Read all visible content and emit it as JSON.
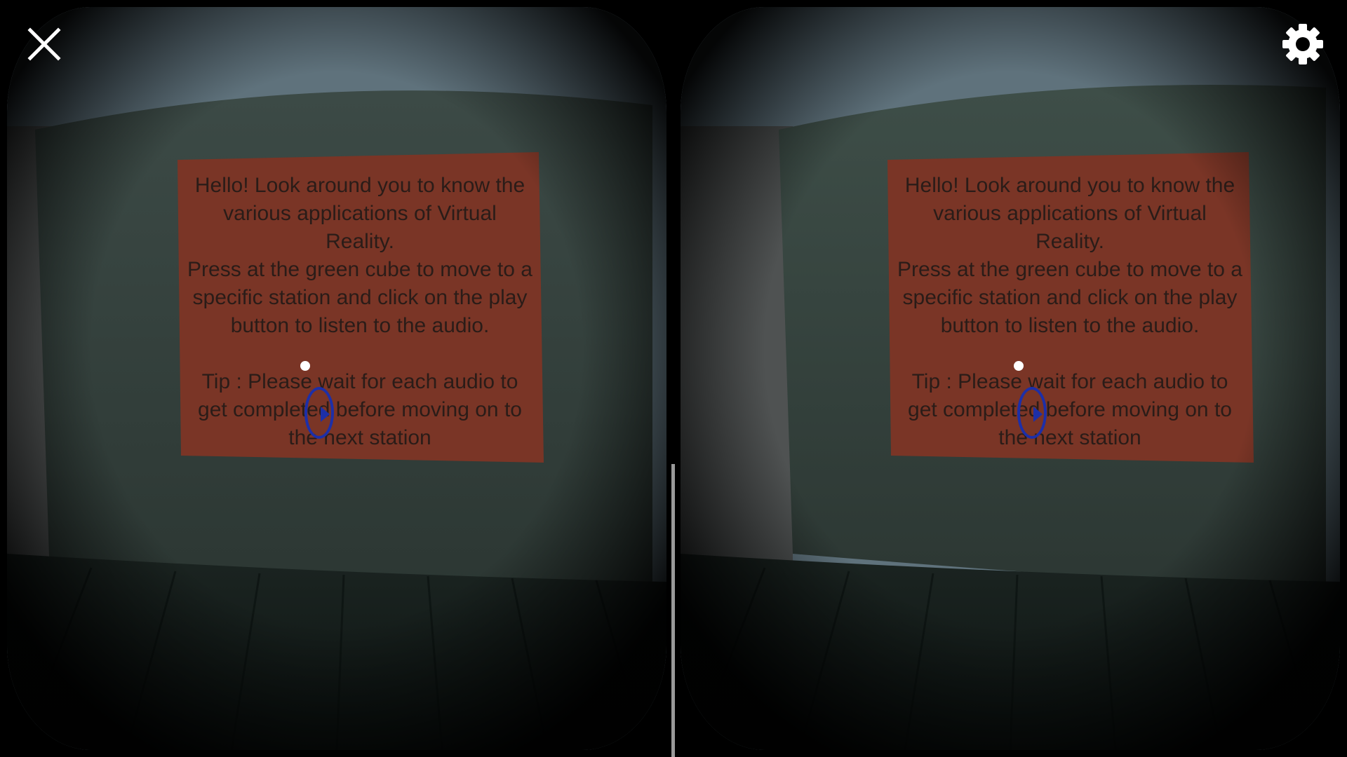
{
  "stereo_view": {
    "panel": {
      "lines": [
        "Hello! Look around you to know the",
        "various applications of Virtual",
        "Reality.",
        "Press at the green cube to move to a",
        "specific station and click on the play",
        "button to listen to the audio.",
        "",
        "Tip : Please wait for each audio to",
        "get completed before moving on to",
        "the next station"
      ]
    },
    "icons": {
      "reticle": "reticle-dot-icon",
      "play": "play-icon"
    }
  },
  "controls": {
    "close_icon": "close-icon",
    "settings_icon": "gear-icon"
  },
  "colors": {
    "panel": "#7a3526",
    "play_button": "#1d2fa8",
    "background": "#000000"
  }
}
